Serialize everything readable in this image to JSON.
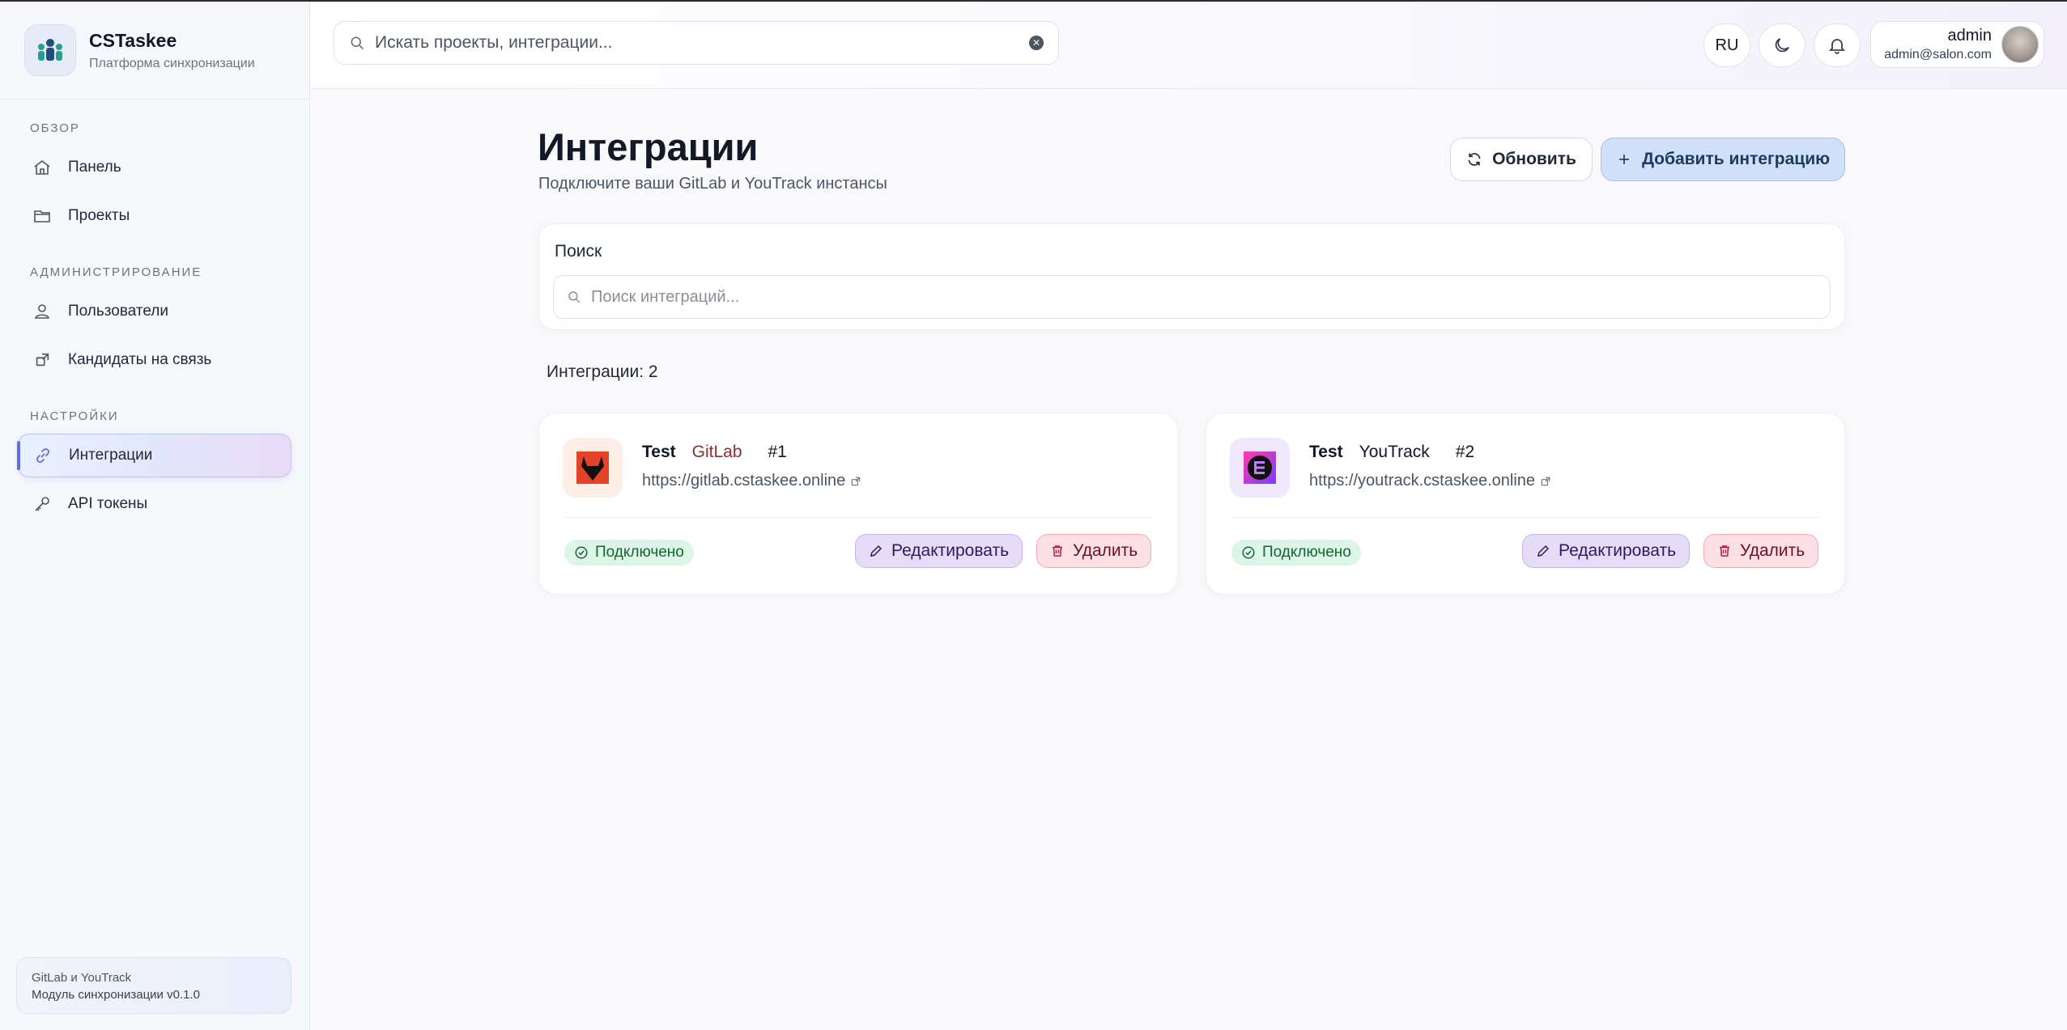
{
  "brand": {
    "title": "CSTaskee",
    "subtitle": "Платформа синхронизации"
  },
  "sidebar": {
    "sections": [
      {
        "title": "ОБЗОР"
      },
      {
        "title": "АДМИНИСТРИРОВАНИЕ"
      },
      {
        "title": "НАСТРОЙКИ"
      }
    ],
    "items": [
      {
        "label": "Панель",
        "icon": "home-icon"
      },
      {
        "label": "Проекты",
        "icon": "folder-icon"
      },
      {
        "label": "Пользователи",
        "icon": "users-icon"
      },
      {
        "label": "Кандидаты на связь",
        "icon": "link-candidates-icon"
      },
      {
        "label": "Интеграции",
        "icon": "link-icon",
        "active": true
      },
      {
        "label": "API токены",
        "icon": "key-icon"
      }
    ],
    "footer": {
      "line1": "GitLab и YouTrack",
      "line2": "Модуль синхронизации v0.1.0"
    }
  },
  "header": {
    "search_placeholder": "Искать проекты, интеграции...",
    "language": "RU",
    "user": {
      "name": "admin",
      "email": "admin@salon.com"
    }
  },
  "main": {
    "title": "Интеграции",
    "subtitle": "Подключите ваши GitLab и YouTrack инстансы",
    "refresh_label": "Обновить",
    "add_label": "Добавить интеграцию",
    "search_label": "Поиск",
    "search_placeholder": "Поиск интеграций...",
    "count_label": "Интеграции: 2",
    "integrations": [
      {
        "name": "Test",
        "type": "GitLab",
        "id": "#1",
        "url": "https://gitlab.cstaskee.online",
        "status": "Подключено",
        "edit_label": "Редактировать",
        "delete_label": "Удалить",
        "type_color": "#8b2f2f"
      },
      {
        "name": "Test",
        "type": "YouTrack",
        "id": "#2",
        "url": "https://youtrack.cstaskee.online",
        "status": "Подключено",
        "edit_label": "Редактировать",
        "delete_label": "Удалить",
        "type_color": "#111827"
      }
    ]
  },
  "colors": {
    "accent": "#5f6fd6",
    "success_bg": "#dcf5e6",
    "success_text": "#166534"
  }
}
